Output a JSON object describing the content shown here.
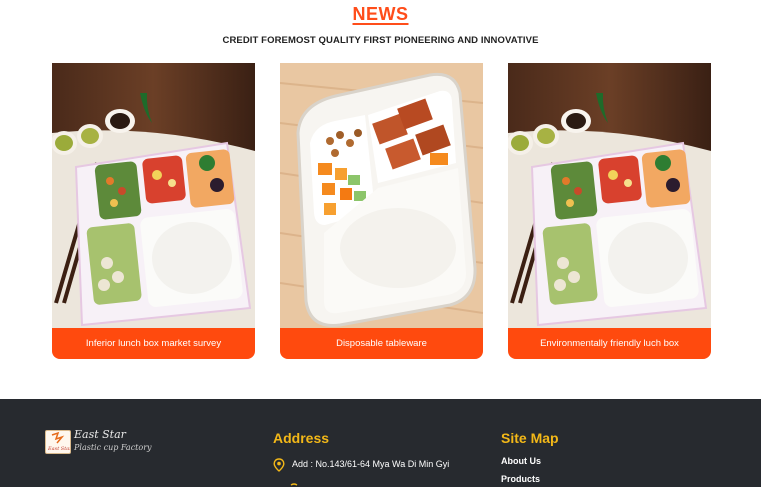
{
  "news": {
    "title": "NEWS",
    "subtitle": "CREDIT FOREMOST QUALITY FIRST PIONEERING AND INNOVATIVE",
    "cards": [
      {
        "caption": "Inferior lunch box market survey",
        "image": "five-compartment-lunch-box-photo"
      },
      {
        "caption": "Disposable tableware",
        "image": "three-compartment-lunch-box-photo"
      },
      {
        "caption": "Environmentally friendly luch box",
        "image": "five-compartment-lunch-box-photo"
      }
    ]
  },
  "footer": {
    "logo": {
      "name": "East Star",
      "tagline": "Plastic cup Factory",
      "badge_text": "East Star"
    },
    "address": {
      "title": "Address",
      "line": "Add : No.143/61-64 Mya Wa Di Min Gyi",
      "icon": "location-pin-icon"
    },
    "sitemap": {
      "title": "Site Map",
      "links": [
        "About Us",
        "Products"
      ]
    }
  },
  "colors": {
    "accent": "#ff4a0e",
    "title_orange": "#ff4d1a",
    "footer_bg": "#272a2f",
    "footer_heading": "#f3b818"
  }
}
